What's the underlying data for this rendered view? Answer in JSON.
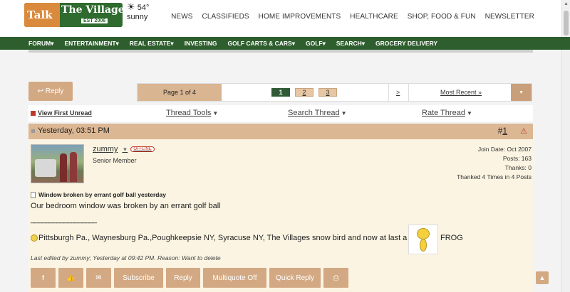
{
  "site": {
    "logo_text_1": "Talk",
    "logo_text_2": "The Villages",
    "logo_est": "EST 2006",
    "weather_temp": "54°",
    "weather_desc": "sunny"
  },
  "top_nav": [
    "NEWS",
    "CLASSIFIEDS",
    "HOME IMPROVEMENTS",
    "HEALTHCARE",
    "SHOP, FOOD & FUN",
    "NEWSLETTER"
  ],
  "main_nav": [
    "FORUM▾",
    "ENTERTAINMENT▾",
    "REAL ESTATE▾",
    "INVESTING",
    "GOLF CARTS & CARS▾",
    "GOLF▾",
    "SEARCH▾",
    "GROCERY DELIVERY"
  ],
  "pagination": {
    "reply_label": "Reply",
    "page_of": "Page 1 of 4",
    "pages": [
      "1",
      "2",
      "3"
    ],
    "current_page": "1",
    "next": ">",
    "most_recent": "Most Recent »"
  },
  "tools": {
    "view_first_unread": "View First Unread",
    "thread_tools": "Thread Tools",
    "search_thread": "Search Thread",
    "rate_thread": "Rate Thread"
  },
  "post": {
    "date": "Yesterday, 03:51 PM",
    "number_prefix": "#",
    "number": "1",
    "username": "zummy",
    "offline_badge": "OFFLINE",
    "user_title": "Senior Member",
    "join_date": "Join Date: Oct 2007",
    "posts": "Posts: 163",
    "thanks": "Thanks: 0",
    "thanked": "Thanked 4 Times in 4 Posts",
    "title": "Window broken by errant golf ball yesterday",
    "body": "Our bedroom window was broken by an errant golf ball",
    "sig_line": "__________________",
    "signature": "Pittsburgh Pa., Waynesburg Pa.,Poughkeepsie NY, Syracuse NY, The Villages snow bird and now at last a",
    "signature_end": "FROG",
    "edited": "Last edited by zummy; Yesterday at 09:42 PM. Reason: Want to delete"
  },
  "actions": {
    "subscribe": "Subscribe",
    "reply": "Reply",
    "multiquote": "Multiquote Off",
    "quick_reply": "Quick Reply"
  },
  "colors": {
    "nav_green": "#2e5e2e",
    "tan": "#dcb793",
    "button_tan": "#d3a983",
    "post_bg": "#fbf4e2"
  }
}
